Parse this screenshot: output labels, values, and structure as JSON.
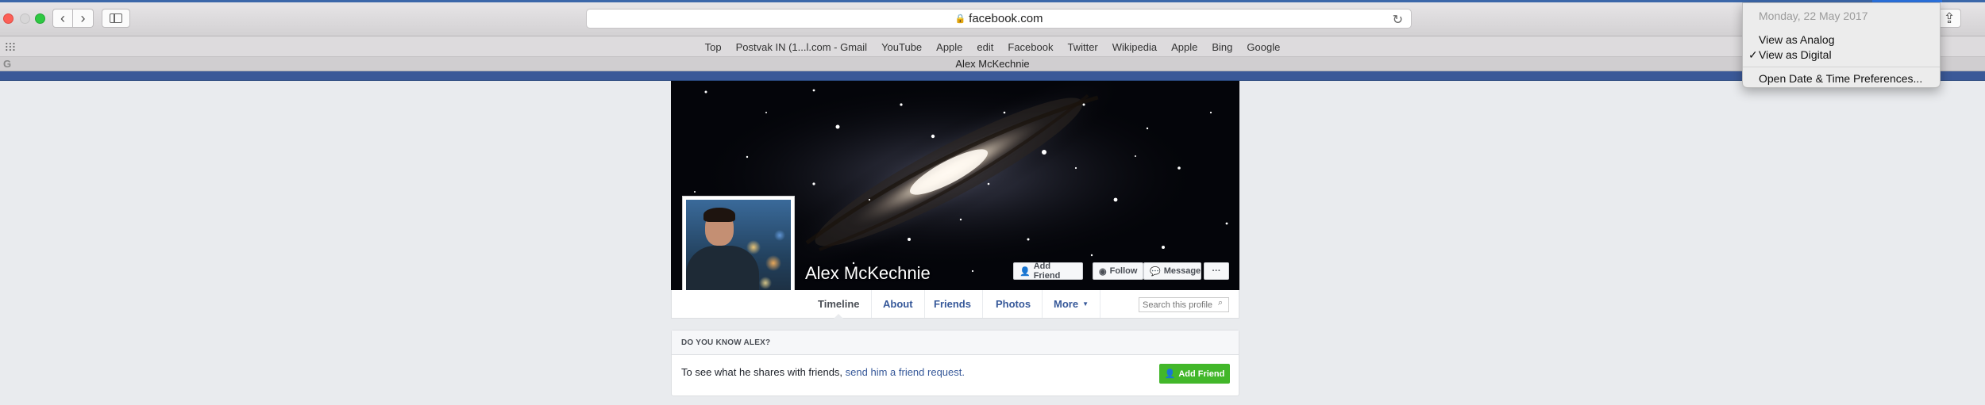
{
  "browser": {
    "address": "facebook.com",
    "favorites": [
      "Top",
      "Postvak IN (1...l.com - Gmail",
      "YouTube",
      "Apple",
      "edit",
      "Facebook",
      "Twitter",
      "Wikipedia",
      "Apple",
      "Bing",
      "Google"
    ],
    "tab_title": "Alex McKechnie",
    "back_glyph": "‹",
    "forward_glyph": "›",
    "reload_glyph": "↻",
    "lock_glyph": "🔒",
    "share_glyph": "⇪",
    "newtab_glyph": "+",
    "tab_icon_letter": "G",
    "icons": [
      "back-icon",
      "forward-icon",
      "sidebar-icon",
      "lock-icon",
      "reload-icon",
      "share-icon",
      "grid-icon"
    ]
  },
  "clock_menu": {
    "date": "Monday, 22 May 2017",
    "items": [
      "View as Analog",
      "View as Digital",
      "Open Date & Time Preferences..."
    ],
    "checked": "View as Digital",
    "check_glyph": "✓"
  },
  "profile": {
    "name": "Alex McKechnie",
    "buttons": {
      "add_friend": "Add Friend",
      "follow": "Follow",
      "message": "Message",
      "more": "···"
    },
    "button_icons": {
      "add_friend": "👤",
      "follow": "◉",
      "message": "💬"
    }
  },
  "nav": {
    "tabs": [
      "Timeline",
      "About",
      "Friends",
      "Photos",
      "More"
    ],
    "more_caret": "▼",
    "search_placeholder": "Search this profile",
    "search_glyph": "⌕"
  },
  "know_card": {
    "heading": "DO YOU KNOW ALEX?",
    "text": "To see what he shares with friends, ",
    "link": "send him a friend request.",
    "button": "Add Friend",
    "button_icon": "👤"
  },
  "colors": {
    "facebook_blue": "#3b5998",
    "link": "#365899",
    "green_button": "#42b72a",
    "page_bg": "#e9ebee"
  }
}
